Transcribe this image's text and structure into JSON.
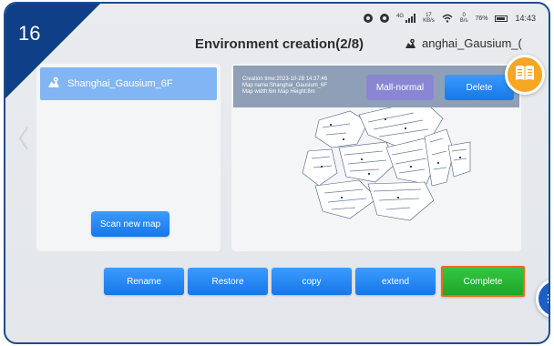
{
  "corner_badge": {
    "number": "16"
  },
  "status_bar": {
    "data_rate_1_top": "17",
    "data_rate_1_unit": "KB/s",
    "data_rate_2_top": "0",
    "data_rate_2_unit": "B/s",
    "network_label": "4G",
    "battery": "76%",
    "time": "14:43"
  },
  "header": {
    "title": "Environment creation(2/8)",
    "current_map": "anghai_Gausium_("
  },
  "map_list": {
    "items": [
      {
        "label": "Shanghai_Gausium_6F",
        "selected": true
      }
    ],
    "scan_button": "Scan new map"
  },
  "map_preview": {
    "creation_time": "Creation time:2023-10-28 14:37:46",
    "map_name": "Map name:Shanghai_Gausium_6F",
    "map_size": "Map width:6m Map Height:8m",
    "mode_button": "Mall-normal",
    "delete_button": "Delete"
  },
  "toolbar": {
    "rename": "Rename",
    "restore": "Restore",
    "copy": "copy",
    "extend": "extend",
    "complete": "Complete"
  },
  "colors": {
    "frame_border": "#1e4d8c",
    "corner_badge": "#0f3f86",
    "primary_button": "#1677e8",
    "selected_item": "#82b5f3",
    "mode_button": "#8b86d3",
    "complete_button": "#1ea62b",
    "complete_outline": "#f06a1d",
    "book_button": "#f5a623"
  },
  "icons": [
    "map-pin-icon",
    "book-icon",
    "menu-icon",
    "chevron-left-icon"
  ]
}
